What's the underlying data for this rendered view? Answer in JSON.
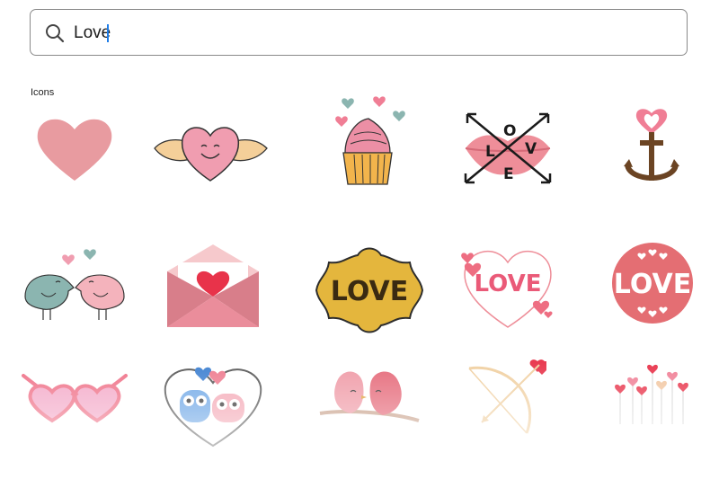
{
  "search": {
    "value": "Love",
    "icon": "search-icon"
  },
  "section": {
    "label": "Icons"
  },
  "icons": [
    {
      "name": "heart-icon"
    },
    {
      "name": "winged-heart-icon"
    },
    {
      "name": "cupcake-icon"
    },
    {
      "name": "crossed-arrows-love-lips-icon",
      "text": [
        "L",
        "O",
        "V",
        "E"
      ]
    },
    {
      "name": "heart-anchor-icon"
    },
    {
      "name": "kissing-birds-icon"
    },
    {
      "name": "love-letter-envelope-icon"
    },
    {
      "name": "love-frame-label-icon",
      "text": "LOVE"
    },
    {
      "name": "love-heart-outline-icon",
      "text": "LOVE"
    },
    {
      "name": "love-circle-badge-icon",
      "text": "LOVE"
    },
    {
      "name": "heart-glasses-icon"
    },
    {
      "name": "owls-in-heart-icon"
    },
    {
      "name": "love-birds-branch-icon"
    },
    {
      "name": "cupid-bow-icon"
    },
    {
      "name": "heart-flowers-icon"
    }
  ],
  "colors": {
    "heart": "#e89ba0",
    "pink": "#f07e95",
    "teal": "#8bb5b0",
    "gold": "#e6b94a",
    "brown": "#6b4423",
    "dark": "#2d2d2d"
  }
}
